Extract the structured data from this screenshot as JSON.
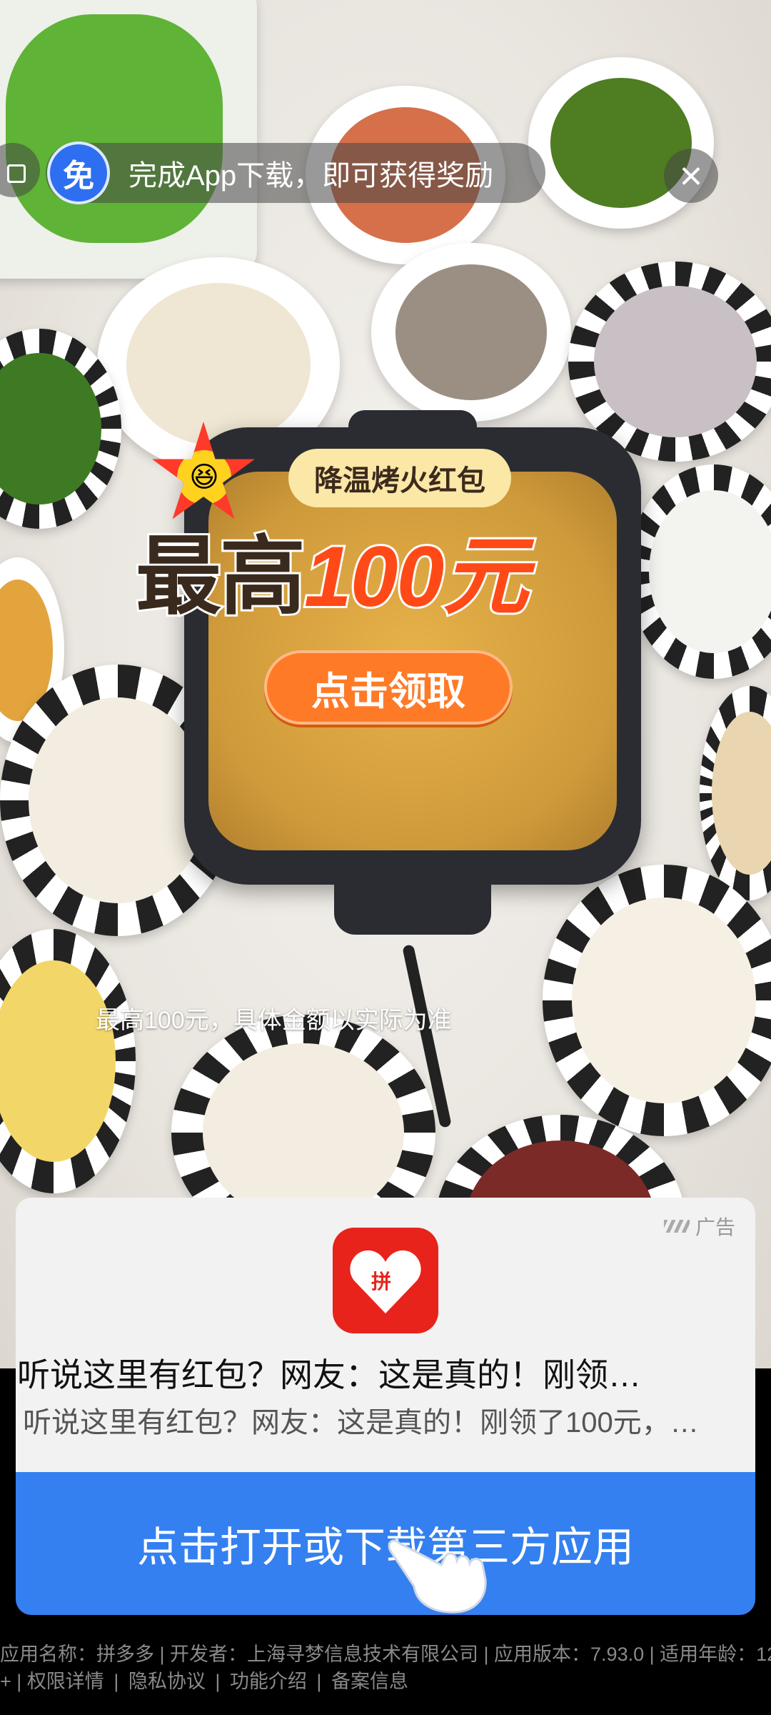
{
  "reward_banner": {
    "badge": "免",
    "text": "完成App下载，即可获得奖励"
  },
  "close_icon": "close-icon",
  "promo": {
    "tag": "降温烤火红包",
    "title_prefix": "最高",
    "title_amount": "100元",
    "button": "点击领取",
    "disclaimer": "最高100元，具体金额以实际为准"
  },
  "ad": {
    "label": "广告",
    "app_icon": "pinduoduo-logo",
    "app_icon_text": "拼",
    "headline": "听说这里有红包？网友：这是真的！刚领…",
    "subline": "听说这里有红包？网友：这是真的！刚领了100元，…",
    "cta": "点击打开或下载第三方应用"
  },
  "footer": {
    "line1": "应用名称：拼多多 | 开发者：上海寻梦信息技术有限公司 | 应用版本：7.93.0 | 适用年龄：12",
    "line2_prefix": "+ |",
    "links": [
      "权限详情",
      "隐私协议",
      "功能介绍",
      "备案信息"
    ]
  },
  "colors": {
    "cta_blue": "#3480f0",
    "badge_blue": "#2d6ff0",
    "promo_orange": "#ff7a27",
    "amount_red": "#ff4a18",
    "brand_red": "#e8231c"
  }
}
